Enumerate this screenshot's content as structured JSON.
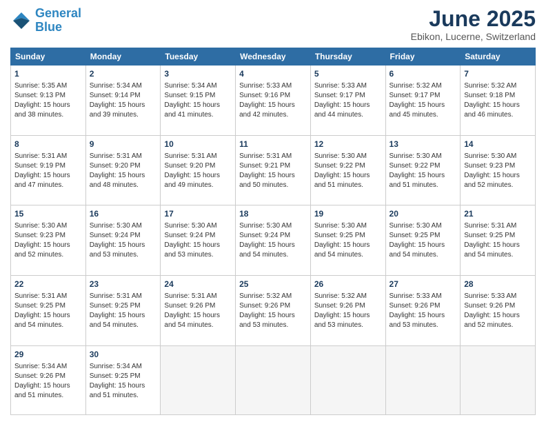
{
  "header": {
    "logo_line1": "General",
    "logo_line2": "Blue",
    "month": "June 2025",
    "location": "Ebikon, Lucerne, Switzerland"
  },
  "columns": [
    "Sunday",
    "Monday",
    "Tuesday",
    "Wednesday",
    "Thursday",
    "Friday",
    "Saturday"
  ],
  "weeks": [
    [
      {
        "day": "1",
        "info": "Sunrise: 5:35 AM\nSunset: 9:13 PM\nDaylight: 15 hours\nand 38 minutes."
      },
      {
        "day": "2",
        "info": "Sunrise: 5:34 AM\nSunset: 9:14 PM\nDaylight: 15 hours\nand 39 minutes."
      },
      {
        "day": "3",
        "info": "Sunrise: 5:34 AM\nSunset: 9:15 PM\nDaylight: 15 hours\nand 41 minutes."
      },
      {
        "day": "4",
        "info": "Sunrise: 5:33 AM\nSunset: 9:16 PM\nDaylight: 15 hours\nand 42 minutes."
      },
      {
        "day": "5",
        "info": "Sunrise: 5:33 AM\nSunset: 9:17 PM\nDaylight: 15 hours\nand 44 minutes."
      },
      {
        "day": "6",
        "info": "Sunrise: 5:32 AM\nSunset: 9:17 PM\nDaylight: 15 hours\nand 45 minutes."
      },
      {
        "day": "7",
        "info": "Sunrise: 5:32 AM\nSunset: 9:18 PM\nDaylight: 15 hours\nand 46 minutes."
      }
    ],
    [
      {
        "day": "8",
        "info": "Sunrise: 5:31 AM\nSunset: 9:19 PM\nDaylight: 15 hours\nand 47 minutes."
      },
      {
        "day": "9",
        "info": "Sunrise: 5:31 AM\nSunset: 9:20 PM\nDaylight: 15 hours\nand 48 minutes."
      },
      {
        "day": "10",
        "info": "Sunrise: 5:31 AM\nSunset: 9:20 PM\nDaylight: 15 hours\nand 49 minutes."
      },
      {
        "day": "11",
        "info": "Sunrise: 5:31 AM\nSunset: 9:21 PM\nDaylight: 15 hours\nand 50 minutes."
      },
      {
        "day": "12",
        "info": "Sunrise: 5:30 AM\nSunset: 9:22 PM\nDaylight: 15 hours\nand 51 minutes."
      },
      {
        "day": "13",
        "info": "Sunrise: 5:30 AM\nSunset: 9:22 PM\nDaylight: 15 hours\nand 51 minutes."
      },
      {
        "day": "14",
        "info": "Sunrise: 5:30 AM\nSunset: 9:23 PM\nDaylight: 15 hours\nand 52 minutes."
      }
    ],
    [
      {
        "day": "15",
        "info": "Sunrise: 5:30 AM\nSunset: 9:23 PM\nDaylight: 15 hours\nand 52 minutes."
      },
      {
        "day": "16",
        "info": "Sunrise: 5:30 AM\nSunset: 9:24 PM\nDaylight: 15 hours\nand 53 minutes."
      },
      {
        "day": "17",
        "info": "Sunrise: 5:30 AM\nSunset: 9:24 PM\nDaylight: 15 hours\nand 53 minutes."
      },
      {
        "day": "18",
        "info": "Sunrise: 5:30 AM\nSunset: 9:24 PM\nDaylight: 15 hours\nand 54 minutes."
      },
      {
        "day": "19",
        "info": "Sunrise: 5:30 AM\nSunset: 9:25 PM\nDaylight: 15 hours\nand 54 minutes."
      },
      {
        "day": "20",
        "info": "Sunrise: 5:30 AM\nSunset: 9:25 PM\nDaylight: 15 hours\nand 54 minutes."
      },
      {
        "day": "21",
        "info": "Sunrise: 5:31 AM\nSunset: 9:25 PM\nDaylight: 15 hours\nand 54 minutes."
      }
    ],
    [
      {
        "day": "22",
        "info": "Sunrise: 5:31 AM\nSunset: 9:25 PM\nDaylight: 15 hours\nand 54 minutes."
      },
      {
        "day": "23",
        "info": "Sunrise: 5:31 AM\nSunset: 9:25 PM\nDaylight: 15 hours\nand 54 minutes."
      },
      {
        "day": "24",
        "info": "Sunrise: 5:31 AM\nSunset: 9:26 PM\nDaylight: 15 hours\nand 54 minutes."
      },
      {
        "day": "25",
        "info": "Sunrise: 5:32 AM\nSunset: 9:26 PM\nDaylight: 15 hours\nand 53 minutes."
      },
      {
        "day": "26",
        "info": "Sunrise: 5:32 AM\nSunset: 9:26 PM\nDaylight: 15 hours\nand 53 minutes."
      },
      {
        "day": "27",
        "info": "Sunrise: 5:33 AM\nSunset: 9:26 PM\nDaylight: 15 hours\nand 53 minutes."
      },
      {
        "day": "28",
        "info": "Sunrise: 5:33 AM\nSunset: 9:26 PM\nDaylight: 15 hours\nand 52 minutes."
      }
    ],
    [
      {
        "day": "29",
        "info": "Sunrise: 5:34 AM\nSunset: 9:26 PM\nDaylight: 15 hours\nand 51 minutes."
      },
      {
        "day": "30",
        "info": "Sunrise: 5:34 AM\nSunset: 9:25 PM\nDaylight: 15 hours\nand 51 minutes."
      },
      {
        "day": "",
        "info": ""
      },
      {
        "day": "",
        "info": ""
      },
      {
        "day": "",
        "info": ""
      },
      {
        "day": "",
        "info": ""
      },
      {
        "day": "",
        "info": ""
      }
    ]
  ]
}
